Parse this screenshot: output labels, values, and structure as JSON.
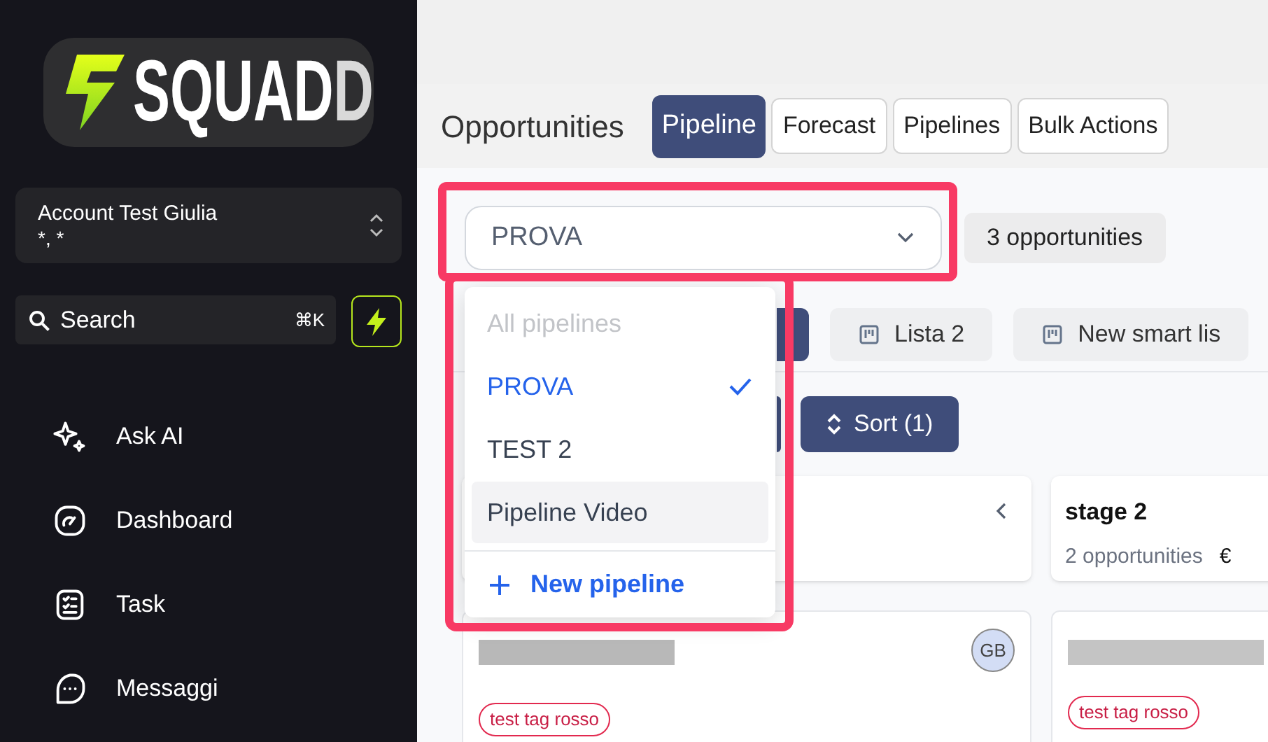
{
  "logo": {
    "bright": "SQUAD",
    "dim": "D"
  },
  "account": {
    "name": "Account Test Giulia",
    "detail": "*, *"
  },
  "search": {
    "placeholder": "Search",
    "shortcut": "⌘K"
  },
  "nav": [
    {
      "label": "Ask AI",
      "kind": "sparkle"
    },
    {
      "label": "Dashboard",
      "kind": "gauge"
    },
    {
      "label": "Task",
      "kind": "checklist"
    },
    {
      "label": "Messaggi",
      "kind": "chat"
    }
  ],
  "page_title": "Opportunities",
  "tabs": [
    {
      "label": "Pipeline",
      "selected": true
    },
    {
      "label": "Forecast",
      "selected": false
    },
    {
      "label": "Pipelines",
      "selected": false
    },
    {
      "label": "Bulk Actions",
      "selected": false
    }
  ],
  "pipeline_select": {
    "value": "PROVA",
    "expanded": true
  },
  "count": "3 opportunities",
  "lists": [
    "Lista 2",
    "New smart lis"
  ],
  "sort": "Sort (1)",
  "dropdown": {
    "items": [
      {
        "label": "All pipelines",
        "disabled": true,
        "selected": false,
        "hovered": false
      },
      {
        "label": "PROVA",
        "disabled": false,
        "selected": true,
        "hovered": false
      },
      {
        "label": "TEST 2",
        "disabled": false,
        "selected": false,
        "hovered": false
      },
      {
        "label": "Pipeline Video",
        "disabled": false,
        "selected": false,
        "hovered": true
      }
    ],
    "action": "New pipeline"
  },
  "stage": {
    "title": "stage 2",
    "count": "2 opportunities",
    "amount": "€"
  },
  "cards": [
    {
      "avatar": "GB",
      "tag": "test tag rosso"
    },
    {
      "tag": "test tag rosso"
    }
  ]
}
